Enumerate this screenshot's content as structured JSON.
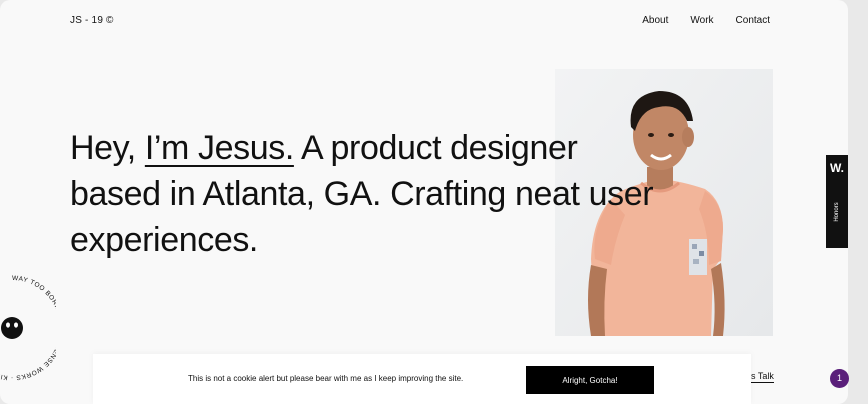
{
  "header": {
    "logo": "JS - 19 ©",
    "nav": [
      "About",
      "Work",
      "Contact"
    ]
  },
  "hero": {
    "intro": "Hey, ",
    "name": "I’m Jesus.",
    "line1_rest": " A product designer",
    "line2": "based in Atlanta, GA. Crafting neat user",
    "line3": "experiences."
  },
  "side_badge": {
    "letter": "W.",
    "label": "Honors"
  },
  "stamp": {
    "ring_text": "WAY TOO BORING · NON SENSE WORKS · KILL"
  },
  "cookie_bar": {
    "message": "This is not a cookie alert but please bear with me as I keep improving the site.",
    "button": "Alright, Gotcha!"
  },
  "cta": {
    "link": "s Talk"
  },
  "notification": {
    "count": "1"
  },
  "colors": {
    "background": "#f9f9f9",
    "text": "#111111",
    "cookie_button": "#000000",
    "notification": "#5a1f7a"
  }
}
